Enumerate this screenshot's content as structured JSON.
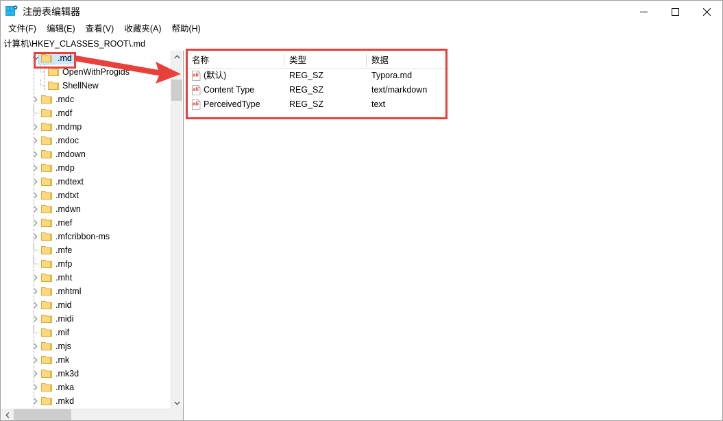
{
  "window": {
    "title": "注册表编辑器",
    "icon": "registry-editor-icon",
    "minimize_label": "—",
    "maximize_label": "☐",
    "close_label": "✕"
  },
  "menubar": {
    "items": [
      {
        "label": "文件(F)",
        "name": "menu-file"
      },
      {
        "label": "编辑(E)",
        "name": "menu-edit"
      },
      {
        "label": "查看(V)",
        "name": "menu-view"
      },
      {
        "label": "收藏夹(A)",
        "name": "menu-favorites"
      },
      {
        "label": "帮助(H)",
        "name": "menu-help"
      }
    ]
  },
  "address": {
    "path": "计算机\\HKEY_CLASSES_ROOT\\.md"
  },
  "tree": {
    "items": [
      {
        "label": ".md",
        "depth": 1,
        "chevron": "expanded",
        "selected": true,
        "highlight": true
      },
      {
        "label": "OpenWithProgids",
        "depth": 2,
        "chevron": "none",
        "selected": false,
        "highlight": false
      },
      {
        "label": "ShellNew",
        "depth": 2,
        "chevron": "none",
        "selected": false,
        "highlight": false
      },
      {
        "label": ".mdc",
        "depth": 1,
        "chevron": "collapsed",
        "selected": false,
        "highlight": false
      },
      {
        "label": ".mdf",
        "depth": 1,
        "chevron": "none",
        "selected": false,
        "highlight": false
      },
      {
        "label": ".mdmp",
        "depth": 1,
        "chevron": "collapsed",
        "selected": false,
        "highlight": false
      },
      {
        "label": ".mdoc",
        "depth": 1,
        "chevron": "collapsed",
        "selected": false,
        "highlight": false
      },
      {
        "label": ".mdown",
        "depth": 1,
        "chevron": "collapsed",
        "selected": false,
        "highlight": false
      },
      {
        "label": ".mdp",
        "depth": 1,
        "chevron": "collapsed",
        "selected": false,
        "highlight": false
      },
      {
        "label": ".mdtext",
        "depth": 1,
        "chevron": "collapsed",
        "selected": false,
        "highlight": false
      },
      {
        "label": ".mdtxt",
        "depth": 1,
        "chevron": "collapsed",
        "selected": false,
        "highlight": false
      },
      {
        "label": ".mdwn",
        "depth": 1,
        "chevron": "collapsed",
        "selected": false,
        "highlight": false
      },
      {
        "label": ".mef",
        "depth": 1,
        "chevron": "collapsed",
        "selected": false,
        "highlight": false
      },
      {
        "label": ".mfcribbon-ms",
        "depth": 1,
        "chevron": "collapsed",
        "selected": false,
        "highlight": false
      },
      {
        "label": ".mfe",
        "depth": 1,
        "chevron": "none",
        "selected": false,
        "highlight": false
      },
      {
        "label": ".mfp",
        "depth": 1,
        "chevron": "none",
        "selected": false,
        "highlight": false
      },
      {
        "label": ".mht",
        "depth": 1,
        "chevron": "collapsed",
        "selected": false,
        "highlight": false
      },
      {
        "label": ".mhtml",
        "depth": 1,
        "chevron": "collapsed",
        "selected": false,
        "highlight": false
      },
      {
        "label": ".mid",
        "depth": 1,
        "chevron": "collapsed",
        "selected": false,
        "highlight": false
      },
      {
        "label": ".midi",
        "depth": 1,
        "chevron": "collapsed",
        "selected": false,
        "highlight": false
      },
      {
        "label": ".mif",
        "depth": 1,
        "chevron": "none",
        "selected": false,
        "highlight": false
      },
      {
        "label": ".mjs",
        "depth": 1,
        "chevron": "collapsed",
        "selected": false,
        "highlight": false
      },
      {
        "label": ".mk",
        "depth": 1,
        "chevron": "collapsed",
        "selected": false,
        "highlight": false
      },
      {
        "label": ".mk3d",
        "depth": 1,
        "chevron": "collapsed",
        "selected": false,
        "highlight": false
      },
      {
        "label": ".mka",
        "depth": 1,
        "chevron": "collapsed",
        "selected": false,
        "highlight": false
      },
      {
        "label": ".mkd",
        "depth": 1,
        "chevron": "collapsed",
        "selected": false,
        "highlight": false
      }
    ]
  },
  "list": {
    "columns": [
      {
        "label": "名称",
        "name": "column-name"
      },
      {
        "label": "类型",
        "name": "column-type"
      },
      {
        "label": "数据",
        "name": "column-data"
      }
    ],
    "rows": [
      {
        "name": "(默认)",
        "type": "REG_SZ",
        "data": "Typora.md",
        "icon": "string-value-icon"
      },
      {
        "name": "Content Type",
        "type": "REG_SZ",
        "data": "text/markdown",
        "icon": "string-value-icon"
      },
      {
        "name": "PerceivedType",
        "type": "REG_SZ",
        "data": "text",
        "icon": "string-value-icon"
      }
    ]
  },
  "annotations": {
    "accent_color": "#e8403a",
    "selection_color": "#cce8ff",
    "folder_color": "#fcd97f"
  }
}
